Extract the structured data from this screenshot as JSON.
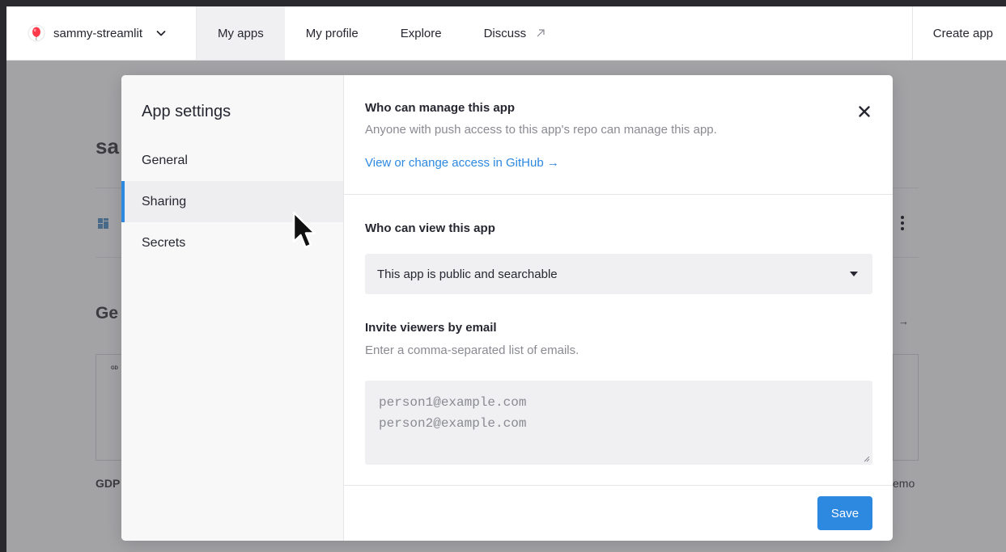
{
  "nav": {
    "workspace": "sammy-streamlit",
    "links": [
      {
        "label": "My apps",
        "active": true
      },
      {
        "label": "My profile",
        "active": false
      },
      {
        "label": "Explore",
        "active": false
      },
      {
        "label": "Discuss",
        "active": false
      }
    ],
    "create_app": "Create app"
  },
  "background": {
    "title_fragment": "sa",
    "section_fragment": "Ge",
    "card_fragment": "GD",
    "caption_left": "GDP",
    "caption_right": "emo",
    "arrow": "→"
  },
  "modal": {
    "sidebar": {
      "title": "App settings",
      "items": [
        {
          "label": "General",
          "active": false
        },
        {
          "label": "Sharing",
          "active": true
        },
        {
          "label": "Secrets",
          "active": false
        }
      ]
    },
    "manage": {
      "title": "Who can manage this app",
      "description": "Anyone with push access to this app's repo can manage this app.",
      "link": "View or change access in GitHub →"
    },
    "view": {
      "title": "Who can view this app",
      "selected": "This app is public and searchable"
    },
    "invite": {
      "title": "Invite viewers by email",
      "description": "Enter a comma-separated list of emails.",
      "placeholder_line1": "person1@example.com",
      "placeholder_line2": "person2@example.com"
    },
    "save_label": "Save"
  },
  "colors": {
    "accent": "#2d88e0",
    "overlay": "#a3a3a6"
  },
  "icons": [
    "balloon-icon",
    "chevron-down-icon",
    "external-link-icon",
    "close-icon",
    "caret-down-icon",
    "grid-icon",
    "kebab-icon",
    "mouse-cursor-icon"
  ]
}
